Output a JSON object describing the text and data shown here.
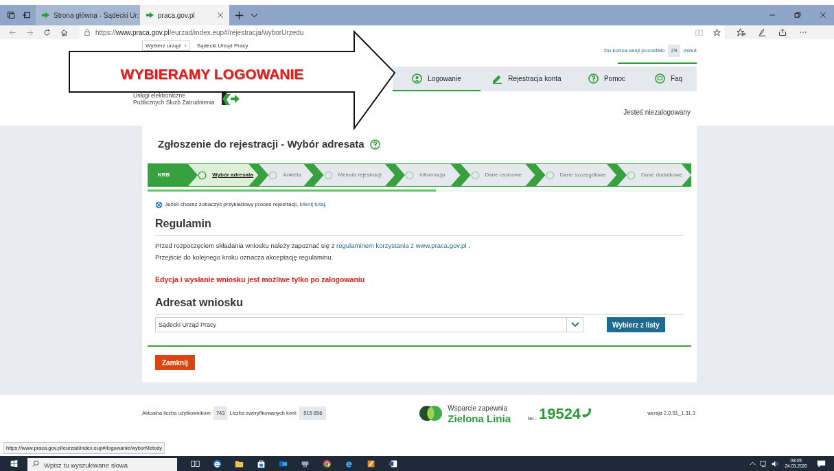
{
  "browser": {
    "tabs": [
      {
        "label": "Strona główna - Sądecki Ur:",
        "selected": false
      },
      {
        "label": "praca.gov.pl",
        "selected": true
      }
    ],
    "url": "https://**www.praca.gov.pl**/eurzad/index.eup#/rejestracja/wyborUrzedu"
  },
  "header": {
    "breadcrumb": {
      "button": "Wybierz urząd",
      "separator": "›",
      "current": "Sądecki Urząd Pracy"
    },
    "session": {
      "label": "Do końca sesji pozostało",
      "minutes": "29",
      "unit": "minut"
    },
    "logo_lines": [
      "Usługi elektroniczne",
      "Publicznych Służb Zatrudnienia"
    ],
    "nav": [
      {
        "label": "Logowanie",
        "selected": true
      },
      {
        "label": "Rejestracja konta",
        "selected": false
      },
      {
        "label": "Pomoc",
        "selected": false
      },
      {
        "label": "Faq",
        "selected": false
      }
    ],
    "login_status": "Jesteś niezalogowany"
  },
  "annotation": {
    "text": "WYBIERAMY LOGOWANIE"
  },
  "form": {
    "title": "Zgłoszenie do rejestracji - Wybór adresata",
    "start_step": "KRB",
    "steps": [
      {
        "label": "Wybór adresata",
        "selected": true
      },
      {
        "label": "Ankieta",
        "selected": false
      },
      {
        "label": "Metoda rejestracji",
        "selected": false
      },
      {
        "label": "Informacja",
        "selected": false
      },
      {
        "label": "Dane osobowe",
        "selected": false
      },
      {
        "label": "Dane szczegółowe",
        "selected": false
      },
      {
        "label": "Dane dodatkowe",
        "selected": false
      }
    ],
    "progress": {
      "level": 0.53
    },
    "demo": {
      "text": "Jeżeli chcesz zobaczyć przykładowy proces rejestracji,",
      "link": "kliknij tutaj",
      "after": "."
    },
    "terms": {
      "heading": "Regulamin",
      "line1_before": "Przed rozpoczęciem składania wniosku należy zapoznać się z",
      "line1_link": "regulaminem korzystania z www.praca.gov.pl",
      "line1_after": ".",
      "line2": "Przejście do kolejnego kroku oznacza akceptację regulaminu.",
      "warning": "Edycja i wysłanie wniosku jest możliwe tylko po zalogowaniu"
    },
    "recipient": {
      "heading": "Adresat wniosku",
      "value": "Sądecki Urząd Pracy",
      "button": "Wybierz z listy"
    },
    "close_button": "Zamknij"
  },
  "footer": {
    "users_label": "Aktualna liczba użytkowników:",
    "users": "743",
    "verified_label": "Liczba zweryfikowanych kont:",
    "verified": "515 856",
    "hotline_top": "Wsparcie zapewnia",
    "hotline_name": "Zielona Linia",
    "tel_label": "tel.:",
    "tel": "19524",
    "version": "wersja 2.0.51_1.31.3"
  },
  "status_url": "https://www.praca.gov.pl/eurzad/index.eup#/logowanie/wyborMetody",
  "taskbar": {
    "search_placeholder": "Wpisz tu wyszukiwane słowa",
    "time": "08:05",
    "date": "24.03.2020"
  }
}
